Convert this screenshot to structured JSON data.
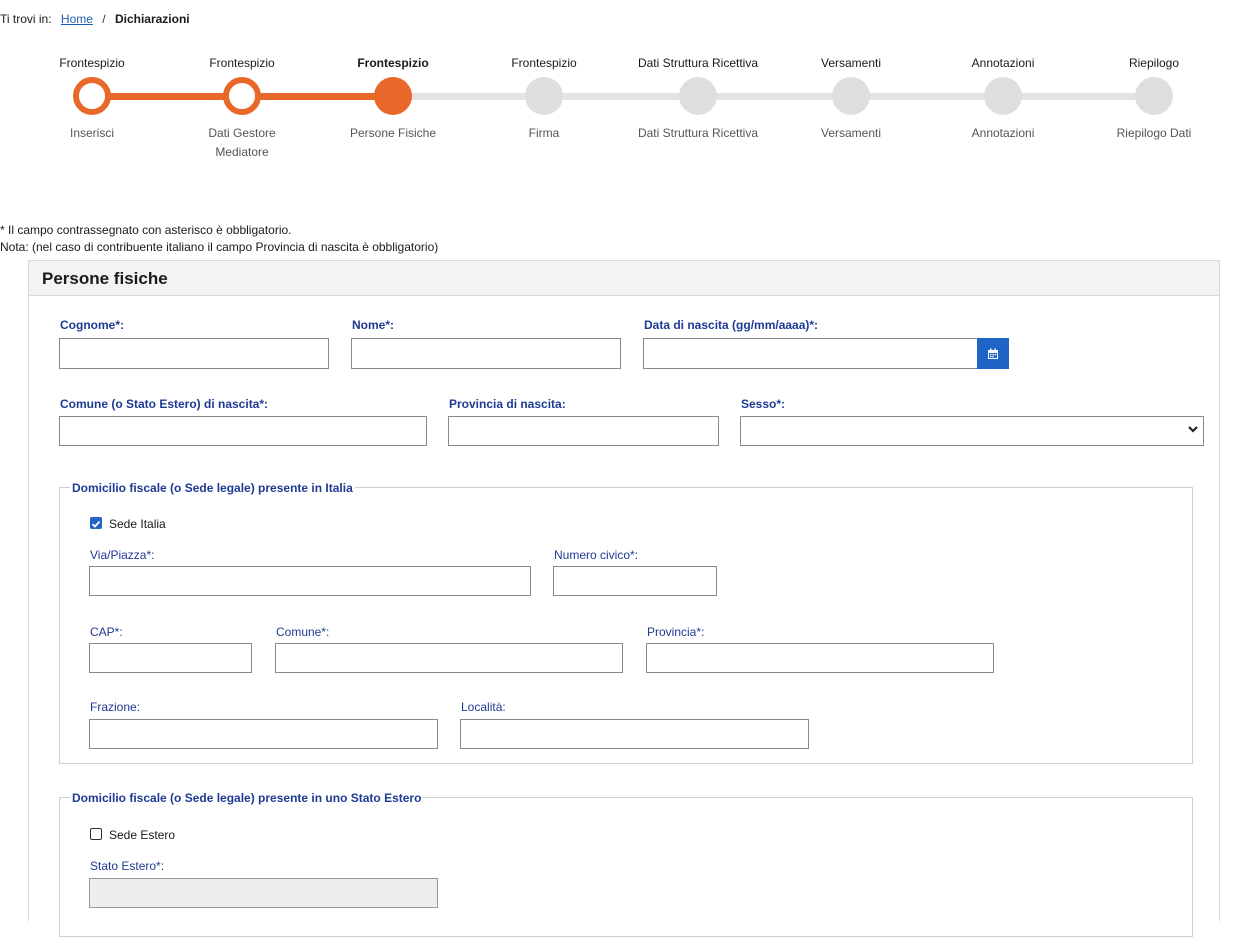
{
  "breadcrumb": {
    "prefix": "Ti trovi in:",
    "home": "Home",
    "separator": "/",
    "current": "Dichiarazioni"
  },
  "stepper": {
    "accent_color": "#e8682a",
    "steps": [
      {
        "title": "Frontespizio",
        "sub": "Inserisci",
        "state": "done"
      },
      {
        "title": "Frontespizio",
        "sub": "Dati Gestore Mediatore",
        "state": "done"
      },
      {
        "title": "Frontespizio",
        "sub": "Persone Fisiche",
        "state": "current"
      },
      {
        "title": "Frontespizio",
        "sub": "Firma",
        "state": "todo"
      },
      {
        "title": "Dati Struttura Ricettiva",
        "sub": "Dati Struttura Ricettiva",
        "state": "todo"
      },
      {
        "title": "Versamenti",
        "sub": "Versamenti",
        "state": "todo"
      },
      {
        "title": "Annotazioni",
        "sub": "Annotazioni",
        "state": "todo"
      },
      {
        "title": "Riepilogo",
        "sub": "Riepilogo Dati",
        "state": "todo"
      }
    ]
  },
  "notes": {
    "required": "* Il campo contrassegnato con asterisco è obbligatorio.",
    "nota": "Nota: (nel caso di contribuente italiano il campo Provincia di nascita è obbligatorio)"
  },
  "panel": {
    "title": "Persone fisiche",
    "fields": {
      "cognome": "Cognome*:",
      "nome": "Nome*:",
      "data_nascita": "Data di nascita (gg/mm/aaaa)*:",
      "comune_nascita": "Comune (o Stato Estero) di nascita*:",
      "provincia_nascita": "Provincia di nascita:",
      "sesso": "Sesso*:"
    },
    "domicilio_italia": {
      "legend": "Domicilio fiscale (o Sede legale) presente in Italia",
      "checkbox_label": "Sede Italia",
      "checked": true,
      "via": "Via/Piazza*:",
      "numero_civico": "Numero civico*:",
      "cap": "CAP*:",
      "comune": "Comune*:",
      "provincia": "Provincia*:",
      "frazione": "Frazione:",
      "localita": "Località:"
    },
    "domicilio_estero": {
      "legend": "Domicilio fiscale (o Sede legale) presente in uno Stato Estero",
      "checkbox_label": "Sede Estero",
      "checked": false,
      "stato_estero": "Stato Estero*:"
    }
  },
  "icons": {
    "calendar": "calendar-icon",
    "select_arrow": "chevron-down-icon",
    "checkbox_checked": "check-icon"
  },
  "colors": {
    "accent": "#e8682a",
    "primary": "#1f64c7",
    "label": "#1f3a93"
  }
}
